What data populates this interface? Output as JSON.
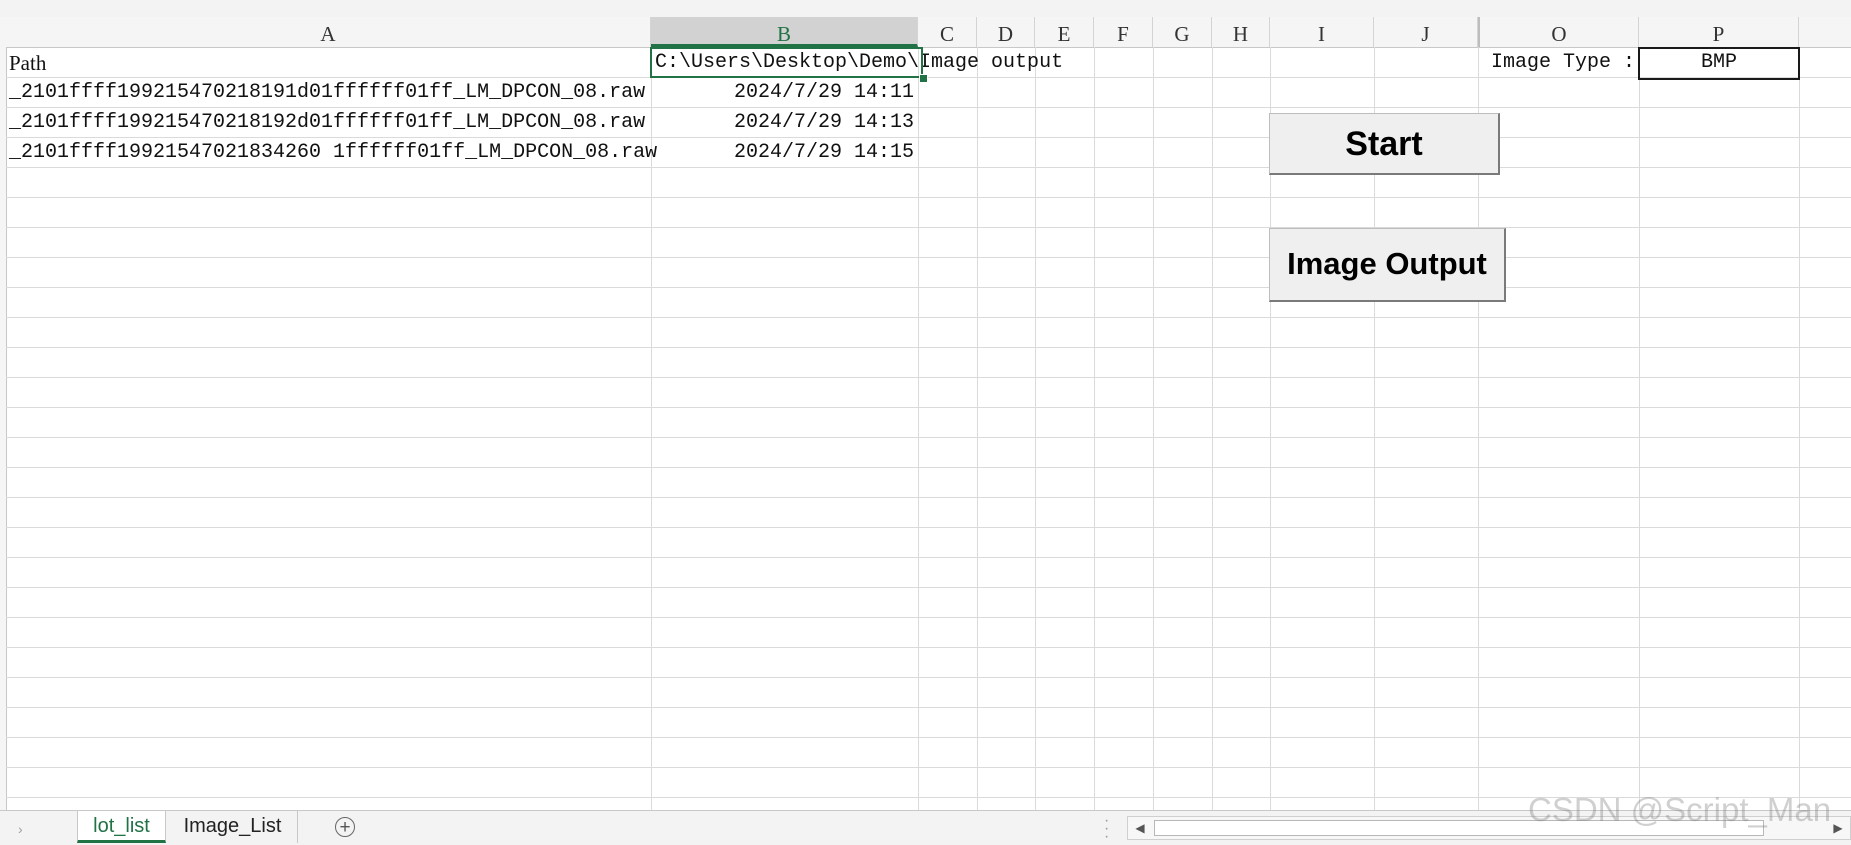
{
  "columns": [
    "A",
    "B",
    "C",
    "D",
    "E",
    "F",
    "G",
    "H",
    "I",
    "J",
    "O",
    "P"
  ],
  "selected_column": "B",
  "header_row": {
    "a1": "Path",
    "b1": "C:\\Users\\Desktop\\Demo\\Image output",
    "o1": "Image Type :",
    "p1": "BMP"
  },
  "rows": [
    {
      "path": "_2101ffff199215470218191d01ffffff01ff_LM_DPCON_08.raw",
      "date": "2024/7/29  14:11"
    },
    {
      "path": "_2101ffff199215470218192d01ffffff01ff_LM_DPCON_08.raw",
      "date": "2024/7/29  14:13"
    },
    {
      "path": "_2101ffff19921547021834260 1ffffff01ff_LM_DPCON_08.raw",
      "date": "2024/7/29  14:15"
    }
  ],
  "buttons": {
    "start": "Start",
    "image_output": "Image Output"
  },
  "sheet_tabs": [
    "lot_list",
    "Image_List"
  ],
  "active_tab": "lot_list",
  "add_sheet_symbol": "+",
  "watermark": "CSDN @Script_Man",
  "colors": {
    "excel_green": "#217346",
    "grid_line": "#dadada"
  }
}
